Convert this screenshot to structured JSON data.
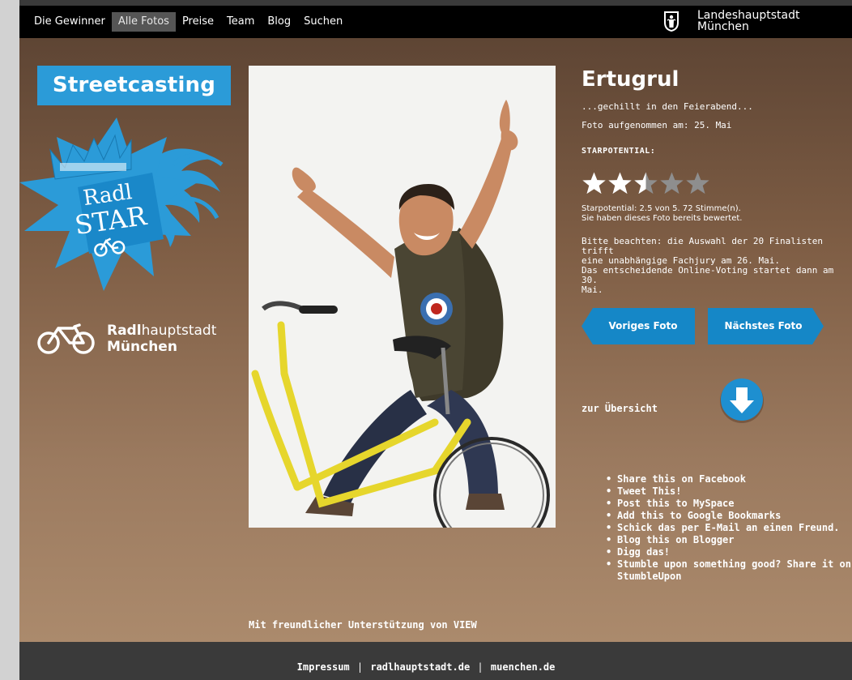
{
  "nav": {
    "items": [
      {
        "label": "Die Gewinner",
        "active": false
      },
      {
        "label": "Alle Fotos",
        "active": true
      },
      {
        "label": "Preise",
        "active": false
      },
      {
        "label": "Team",
        "active": false
      },
      {
        "label": "Blog",
        "active": false
      },
      {
        "label": "Suchen",
        "active": false
      }
    ]
  },
  "city": {
    "line1": "Landeshauptstadt",
    "line2": "München"
  },
  "sidebar": {
    "streetcasting": "Streetcasting",
    "logo_text_1": "Radl",
    "logo_text_2": "STAR",
    "radlhauptstadt_bold": "Radl",
    "radlhauptstadt_rest": "hauptstadt",
    "muenchen": "München"
  },
  "photo": {
    "name": "Ertugrul",
    "caption": "...gechillt in den Feierabend...",
    "date": "Foto aufgenommen am: 25. Mai",
    "starpotential_label": "STARPOTENTIAL:",
    "rating_value": 2.5,
    "rating_max": 5,
    "rating_line1": "Starpotential: 2.5 von 5. 72 Stimme(n).",
    "rating_line2": "Sie haben dieses Foto bereits bewertet.",
    "notice_1": "Bitte beachten: die Auswahl der 20 Finalisten trifft",
    "notice_2": "eine unabhängige Fachjury am 26. Mai.",
    "notice_3": "Das entscheidende Online-Voting startet dann am 30.",
    "notice_4": "Mai."
  },
  "buttons": {
    "prev": "Voriges Foto",
    "next": "Nächstes Foto",
    "overview": "zur Übersicht"
  },
  "share": [
    "Share this on Facebook",
    "Tweet This!",
    "Post this to MySpace",
    "Add this to Google Bookmarks",
    "Schick das per E-Mail an einen Freund.",
    "Blog this on Blogger",
    "Digg das!",
    "Stumble upon something good? Share it on StumbleUpon"
  ],
  "sponsor": "Mit freundlicher Unterstützung von VIEW",
  "footer": {
    "links": [
      "Impressum",
      "radlhauptstadt.de",
      "muenchen.de"
    ],
    "separator": "|"
  },
  "colors": {
    "accent_blue": "#2b9bd8",
    "button_blue": "#1587c7",
    "bar": "#000000"
  }
}
